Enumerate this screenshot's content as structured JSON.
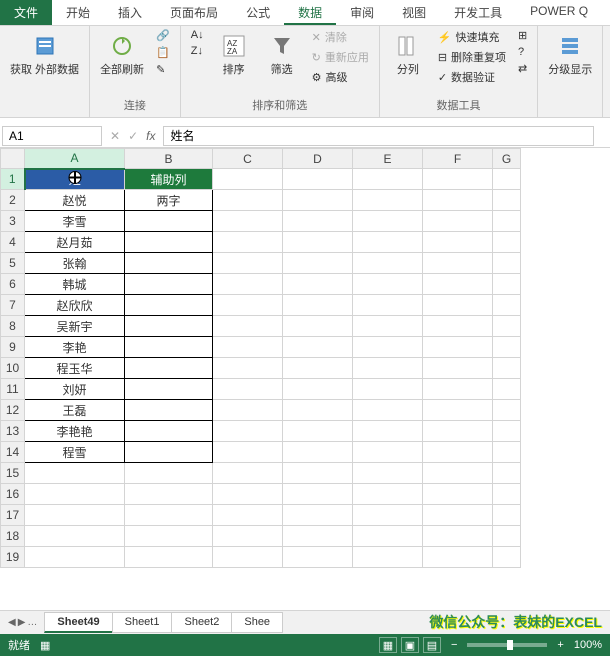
{
  "ribbon": {
    "tabs": [
      "文件",
      "开始",
      "插入",
      "页面布局",
      "公式",
      "数据",
      "审阅",
      "视图",
      "开发工具",
      "POWER Q"
    ],
    "active_tab": "数据",
    "groups": {
      "get_data": {
        "label": "获取\n外部数据"
      },
      "connections": {
        "refresh": "全部刷新",
        "label": "连接"
      },
      "sort_filter": {
        "sort_az": "A→Z",
        "sort_za": "Z→A",
        "sort": "排序",
        "filter": "筛选",
        "clear": "清除",
        "reapply": "重新应用",
        "advanced": "高级",
        "label": "排序和筛选"
      },
      "data_tools": {
        "text_to_cols": "分列",
        "flash_fill": "快速填充",
        "remove_dup": "删除重复项",
        "validation": "数据验证",
        "label": "数据工具"
      },
      "outline": {
        "group": "分级显示",
        "label": ""
      }
    }
  },
  "name_box": "A1",
  "formula_bar": "姓名",
  "columns": [
    "A",
    "B",
    "C",
    "D",
    "E",
    "F",
    "G"
  ],
  "chart_data": {
    "type": "table",
    "headers": [
      "姓名",
      "辅助列"
    ],
    "rows": [
      [
        "赵悦",
        "两字"
      ],
      [
        "李雪",
        ""
      ],
      [
        "赵月茹",
        ""
      ],
      [
        "张翰",
        ""
      ],
      [
        "韩城",
        ""
      ],
      [
        "赵欣欣",
        ""
      ],
      [
        "吴新宇",
        ""
      ],
      [
        "李艳",
        ""
      ],
      [
        "程玉华",
        ""
      ],
      [
        "刘妍",
        ""
      ],
      [
        "王磊",
        ""
      ],
      [
        "李艳艳",
        ""
      ],
      [
        "程雪",
        ""
      ]
    ]
  },
  "total_rows": 19,
  "sheets": [
    "Sheet49",
    "Sheet1",
    "Sheet2",
    "Shee"
  ],
  "active_sheet": "Sheet49",
  "watermark": "微信公众号：表妹的EXCEL",
  "status": {
    "ready": "就绪",
    "zoom": "100%"
  }
}
